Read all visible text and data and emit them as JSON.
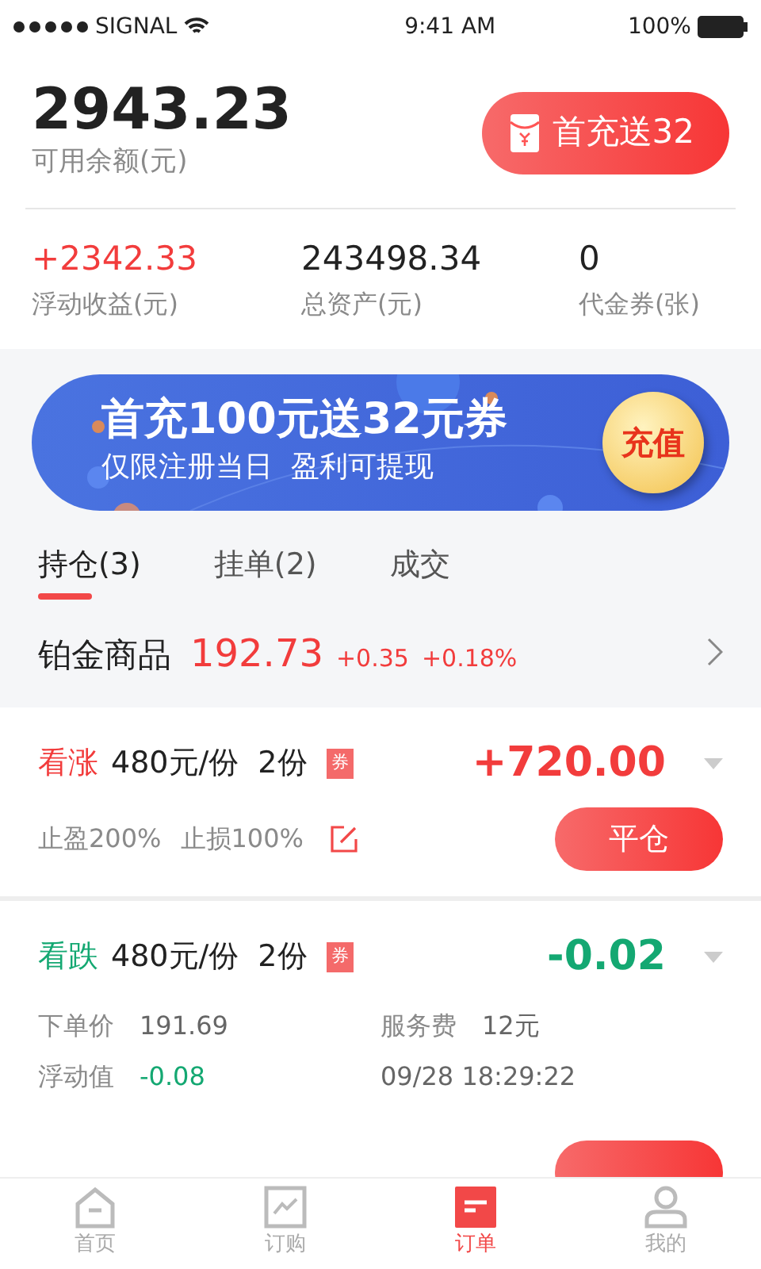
{
  "status_bar": {
    "carrier": "SIGNAL",
    "time": "9:41 AM",
    "battery": "100%"
  },
  "account": {
    "balance": "2943.23",
    "balance_label": "可用余额(元)",
    "promo_button": "首充送32",
    "stats": [
      {
        "value": "+2342.33",
        "label": "浮动收益(元)",
        "color": "#f23c3c"
      },
      {
        "value": "243498.34",
        "label": "总资产(元)",
        "color": "#222222"
      },
      {
        "value": "0",
        "label": "代金券(张)",
        "color": "#222222"
      }
    ]
  },
  "banner": {
    "title": "首充100元送32元券",
    "subtitle": "仅限注册当日  盈利可提现",
    "button": "充值"
  },
  "tabs": [
    {
      "label": "持仓(3)",
      "selected": true
    },
    {
      "label": "挂单(2)",
      "selected": false
    },
    {
      "label": "成交",
      "selected": false
    }
  ],
  "product": {
    "name": "铂金商品",
    "price": "192.73",
    "change": "+0.35",
    "percent": "+0.18%"
  },
  "positions": [
    {
      "direction": "看涨",
      "color": "#f23c3c",
      "price": "480元/份",
      "qty": "2份",
      "coupon": "券",
      "pnl": "+720.00",
      "take_profit": "止盈200%",
      "stop_loss": "止损100%",
      "close": "平仓"
    },
    {
      "direction": "看跌",
      "color": "#14a872",
      "price": "480元/份",
      "qty": "2份",
      "coupon": "券",
      "pnl": "-0.02",
      "details": [
        {
          "label": "下单价",
          "value": "191.69",
          "color": "#666666"
        },
        {
          "label": "服务费",
          "value": "12元",
          "color": "#666666"
        },
        {
          "label": "浮动值",
          "value": "-0.08",
          "color": "#14a872"
        },
        {
          "value": "09/28 18:29:22",
          "color": "#666666"
        }
      ]
    }
  ],
  "tab_bar": [
    {
      "label": "首页",
      "kind": "home",
      "selected": false
    },
    {
      "label": "订购",
      "kind": "chart",
      "selected": false
    },
    {
      "label": "订单",
      "kind": "orders",
      "selected": true
    },
    {
      "label": "我的",
      "kind": "profile",
      "selected": false
    }
  ]
}
